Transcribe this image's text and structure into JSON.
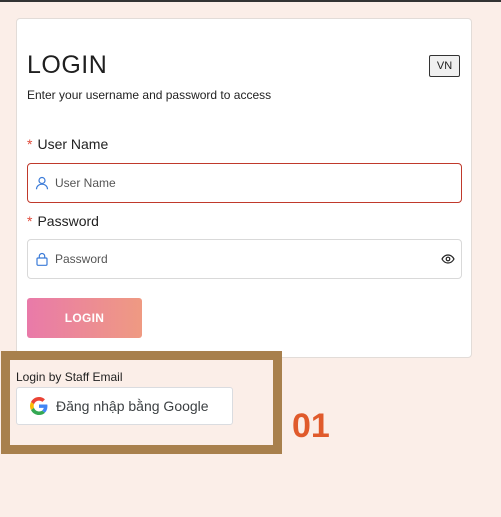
{
  "form": {
    "title": "LOGIN",
    "subtitle": "Enter your username and password to access",
    "language_button": "VN",
    "required_mark": "*",
    "username": {
      "label": "User Name",
      "placeholder": "User Name",
      "value": ""
    },
    "password": {
      "label": "Password",
      "placeholder": "Password",
      "value": ""
    },
    "submit_label": "LOGIN"
  },
  "staff_login": {
    "label": "Login by Staff Email",
    "google_button_label": "Đăng nhập bằng Google"
  },
  "annotation": {
    "step_number": "01"
  },
  "icons": {
    "username": "user-icon",
    "password": "lock-icon",
    "toggle_visibility": "eye-icon",
    "google": "google-icon"
  },
  "colors": {
    "page_background": "#fbeee8",
    "required_asterisk": "#e04a3a",
    "focused_border": "#c0392b",
    "login_gradient_start": "#e97aa9",
    "login_gradient_end": "#ef9a82",
    "highlight_frame": "#a8804d",
    "step_number": "#e05a2b"
  }
}
